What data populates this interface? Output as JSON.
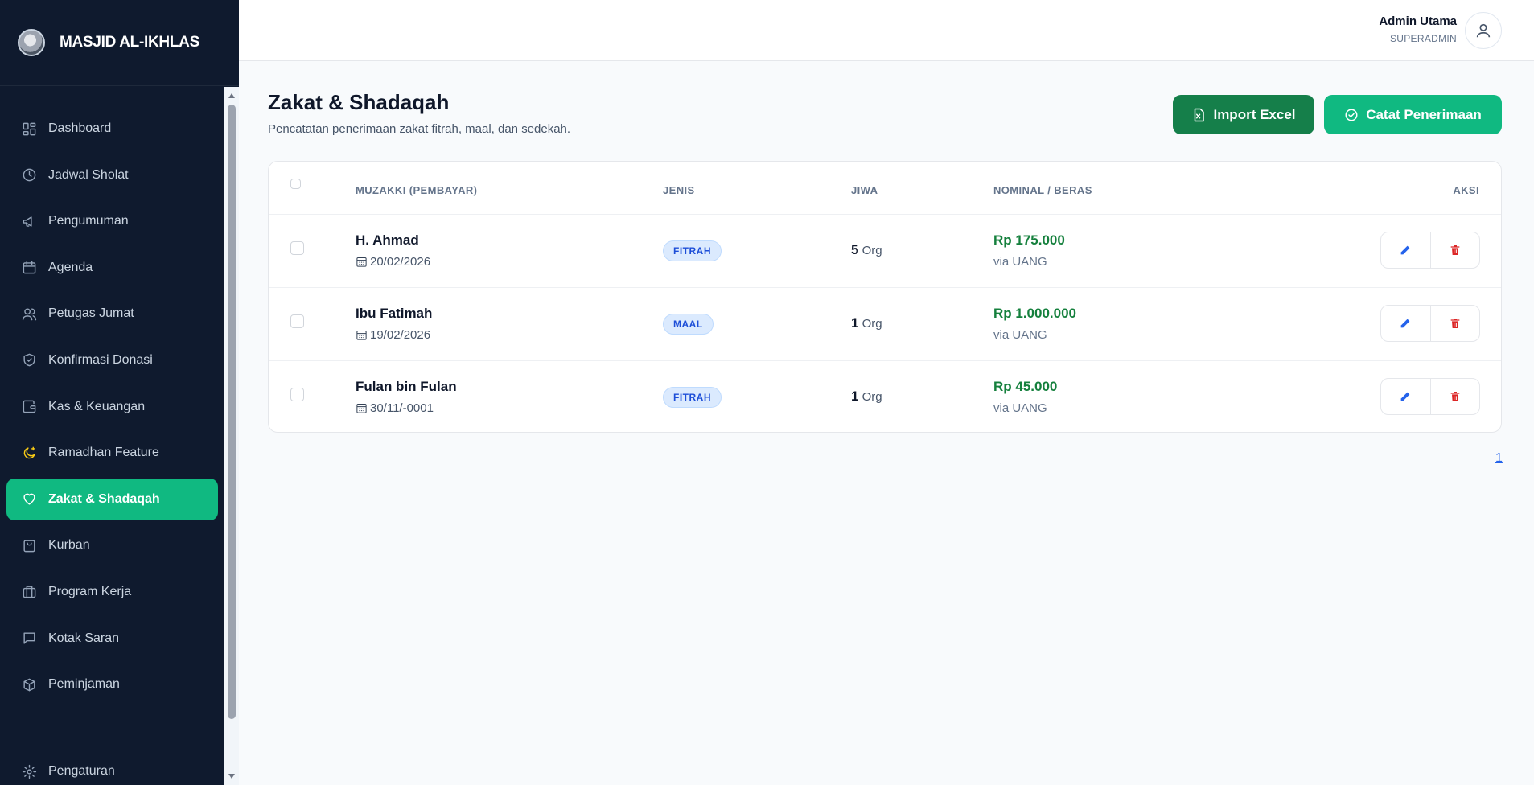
{
  "brand": {
    "title": "MASJID AL-IKHLAS"
  },
  "sidebar": {
    "items": [
      {
        "label": "Dashboard",
        "icon": "grid-icon"
      },
      {
        "label": "Jadwal Sholat",
        "icon": "clock-icon"
      },
      {
        "label": "Pengumuman",
        "icon": "megaphone-icon"
      },
      {
        "label": "Agenda",
        "icon": "calendar-icon"
      },
      {
        "label": "Petugas Jumat",
        "icon": "users-icon"
      },
      {
        "label": "Konfirmasi Donasi",
        "icon": "shield-check-icon"
      },
      {
        "label": "Kas & Keuangan",
        "icon": "wallet-icon"
      },
      {
        "label": "Ramadhan Feature",
        "icon": "moon-icon"
      },
      {
        "label": "Zakat & Shadaqah",
        "icon": "heart-icon"
      },
      {
        "label": "Kurban",
        "icon": "bag-icon"
      },
      {
        "label": "Program Kerja",
        "icon": "briefcase-icon"
      },
      {
        "label": "Kotak Saran",
        "icon": "message-icon"
      },
      {
        "label": "Peminjaman",
        "icon": "box-icon"
      }
    ],
    "active": "Zakat & Shadaqah",
    "settings": {
      "label": "Pengaturan",
      "icon": "gear-icon"
    }
  },
  "user": {
    "name": "Admin Utama",
    "role": "SUPERADMIN"
  },
  "page": {
    "title": "Zakat & Shadaqah",
    "subtitle": "Pencatatan penerimaan zakat fitrah, maal, dan sedekah.",
    "import_label": "Import Excel",
    "record_label": "Catat Penerimaan"
  },
  "table": {
    "headers": {
      "muzakki": "MUZAKKI (PEMBAYAR)",
      "jenis": "JENIS",
      "jiwa": "JIWA",
      "nominal": "NOMINAL / BERAS",
      "aksi": "AKSI"
    },
    "rows": [
      {
        "name": "H. Ahmad",
        "date": "20/02/2026",
        "type": "FITRAH",
        "souls": "5",
        "unit": "Org",
        "amount": "Rp 175.000",
        "via": "via UANG"
      },
      {
        "name": "Ibu Fatimah",
        "date": "19/02/2026",
        "type": "MAAL",
        "souls": "1",
        "unit": "Org",
        "amount": "Rp 1.000.000",
        "via": "via UANG"
      },
      {
        "name": "Fulan bin Fulan",
        "date": "30/11/-0001",
        "type": "FITRAH",
        "souls": "1",
        "unit": "Org",
        "amount": "Rp 45.000",
        "via": "via UANG"
      }
    ]
  },
  "pagination": {
    "current": "1"
  },
  "colors": {
    "sidebar_bg": "#0f1a2e",
    "accent": "#10b981",
    "import_btn": "#157f4a",
    "amount": "#15803d",
    "badge_text": "#1d4ed8",
    "delete": "#dc2626"
  }
}
